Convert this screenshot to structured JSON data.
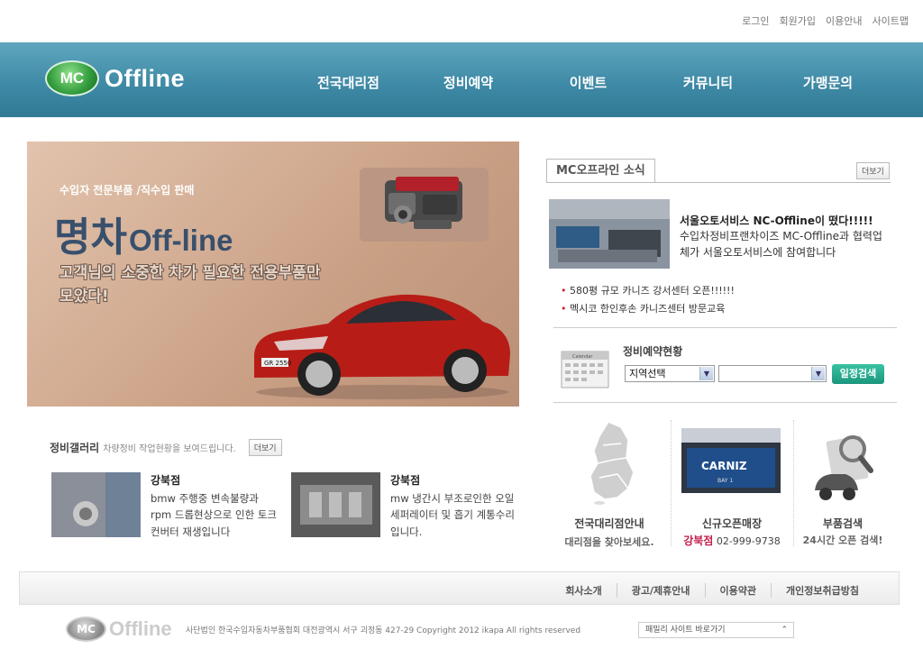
{
  "top_links": [
    "로그인",
    "회원가입",
    "이용안내",
    "사이트맵"
  ],
  "logo": {
    "mark": "MC",
    "text": "Offline"
  },
  "nav": [
    "전국대리점",
    "정비예약",
    "이벤트",
    "커뮤니티",
    "가맹문의"
  ],
  "banner": {
    "subtitle": "수입자 전문부품 /직수입 판매",
    "title_main": "명차",
    "title_sub": "Off-line",
    "desc": "고객님의 소중한 차가 필요한 전용부품만 모았다!",
    "plate": "GR 2550"
  },
  "gallery": {
    "title": "정비갤러리",
    "desc": "차량정비 작업현황을 보여드립니다.",
    "more": "더보기",
    "items": [
      {
        "name": "강북점",
        "body": "bmw 주행중 변속불량과 rpm 드롭현상으로 인한 토크 컨버터 재생입니다"
      },
      {
        "name": "강북점",
        "body": "mw 냉간시 부조로인한 오일세퍼레이터 및 흡기 계통수리입니다."
      }
    ]
  },
  "news": {
    "tab": "MC오프라인 소식",
    "more": "더보기",
    "headline": "서울오토서비스 NC-Offline이 떴다!!!!!",
    "body": "수입차정비프랜차이즈 MC-Offline과 협력업체가 서울오토서비스에 참여합니다",
    "list": [
      "580평 규모 카니즈 강서센터 오픈!!!!!!",
      "멕시코 한인후손 카니즈센터 방문교육"
    ]
  },
  "reservation": {
    "title": "정비예약현황",
    "region_select": "지역선택",
    "second_select": "",
    "button": "일정검색",
    "calendar_label": "Calendar"
  },
  "services": [
    {
      "title": "전국대리점안내",
      "sub": "대리점을 찾아보세요."
    },
    {
      "title": "신규오픈매장",
      "store": "강북점",
      "phone": "02-999-9738",
      "sign": "CARNIZ",
      "bay": "BAY 1"
    },
    {
      "title": "부품검색",
      "sub": "24시간 오픈 검색!"
    }
  ],
  "footer": {
    "links": [
      "회사소개",
      "광고/제휴안내",
      "이용약관",
      "개인정보취급방침"
    ],
    "copyright": "사단법인 한국수입자동차부품협회 대전광역시 서구 괴정동 427-29 Copyright 2012 ikapa All rights reserved",
    "family_site": "패밀리 사이트 바로가기"
  },
  "colors": {
    "header": "#3f8aa6",
    "accent_green": "#1b967d",
    "store_red": "#c21e4a"
  }
}
